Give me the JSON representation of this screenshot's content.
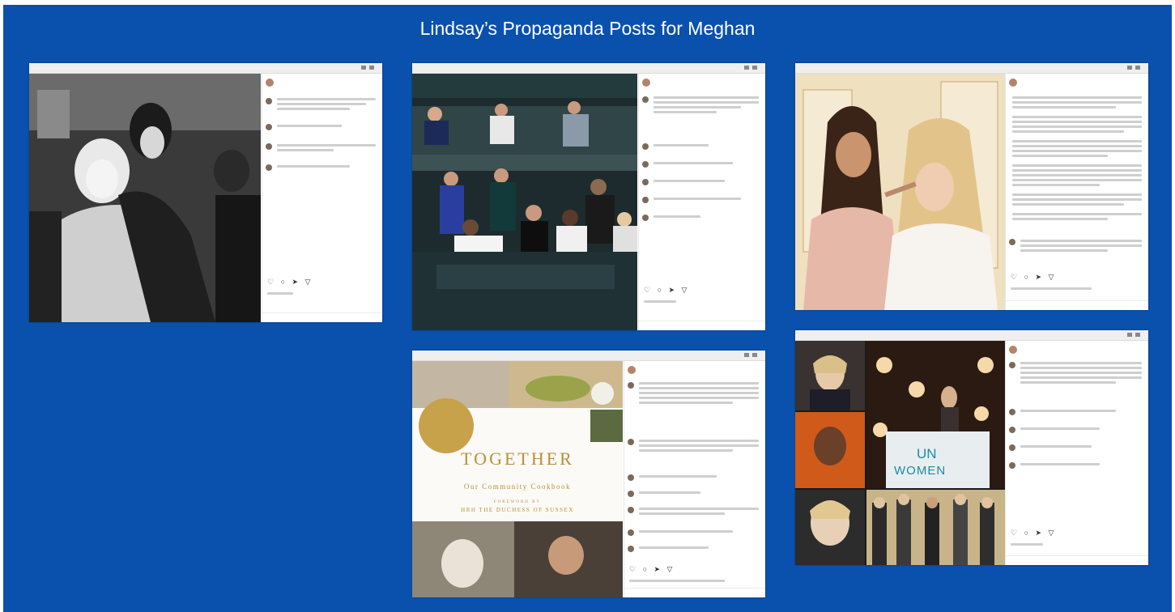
{
  "page": {
    "title": "Lindsay’s Propaganda Posts for Meghan"
  },
  "colors": {
    "background": "#0a51ae",
    "link": "#3897f0"
  },
  "cookbook": {
    "title": "TOGETHER",
    "subtitle": "Our Community Cookbook",
    "foreword_label": "FOREWORD BY",
    "foreword_by": "HRH THE DUCHESS OF SUSSEX"
  },
  "un_women": {
    "line1": "UN",
    "line2": "WOMEN"
  },
  "icons": {
    "actions": "heart-icon, comment-icon, share-icon, bookmark-icon",
    "avatar": "profile-avatar-icon"
  }
}
